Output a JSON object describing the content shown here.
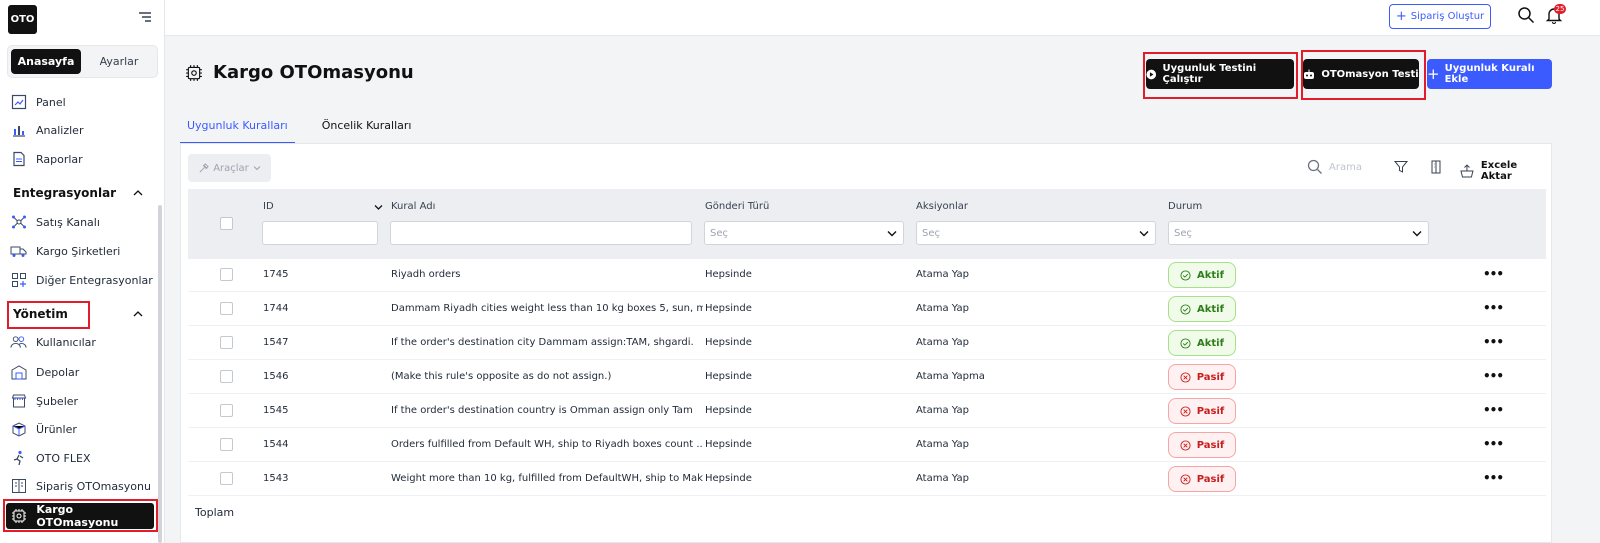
{
  "brand": {
    "logo": "OTO"
  },
  "sidebar": {
    "segment": {
      "home": "Anasayfa",
      "settings": "Ayarlar"
    },
    "top_items": [
      {
        "label": "Panel",
        "icon": "panel-icon"
      },
      {
        "label": "Analizler",
        "icon": "chart-icon"
      },
      {
        "label": "Raporlar",
        "icon": "report-icon"
      }
    ],
    "section_integrations": "Entegrasyonlar",
    "integration_items": [
      {
        "label": "Satış Kanalı",
        "icon": "network-icon"
      },
      {
        "label": "Kargo Şirketleri",
        "icon": "truck-icon"
      },
      {
        "label": "Diğer Entegrasyonlar",
        "icon": "grid-plus-icon"
      }
    ],
    "section_management": "Yönetim",
    "management_items": [
      {
        "label": "Kullanıcılar",
        "icon": "users-icon"
      },
      {
        "label": "Depolar",
        "icon": "warehouse-icon"
      },
      {
        "label": "Şubeler",
        "icon": "store-icon"
      },
      {
        "label": "Ürünler",
        "icon": "box-icon"
      },
      {
        "label": "OTO FLEX",
        "icon": "runner-icon"
      },
      {
        "label": "Sipariş OTOmasyonu",
        "icon": "order-automation-icon"
      },
      {
        "label": "Kargo OTOmasyonu",
        "icon": "cargo-automation-icon"
      }
    ]
  },
  "topbar": {
    "create_order": "Sipariş Oluştur",
    "notification_count": "25"
  },
  "page": {
    "title": "Kargo OTOmasyonu",
    "btn_run_test": "Uygunluk Testini Çalıştır",
    "btn_automation_test": "OTOmasyon Testi",
    "btn_add_rule": "Uygunluk Kuralı Ekle",
    "tabs": [
      "Uygunluk Kuralları",
      "Öncelik Kuralları"
    ]
  },
  "toolbar": {
    "tools": "Araçlar",
    "search_placeholder": "Arama",
    "export": "Excele Aktar"
  },
  "table": {
    "headers": {
      "id": "ID",
      "name": "Kural Adı",
      "shipment": "Gönderi Türü",
      "actions": "Aksiyonlar",
      "status": "Durum"
    },
    "select_placeholder": "Seç",
    "rows": [
      {
        "id": "1745",
        "name": "Riyadh orders",
        "shipment": "Hepsinde",
        "action": "Atama Yap",
        "status": "Aktif"
      },
      {
        "id": "1744",
        "name": "Dammam Riyadh cities weight less than 10 kg boxes 5, sun, m...",
        "shipment": "Hepsinde",
        "action": "Atama Yap",
        "status": "Aktif"
      },
      {
        "id": "1547",
        "name": "If the order's destination city Dammam assign:TAM, shgardi.",
        "shipment": "Hepsinde",
        "action": "Atama Yap",
        "status": "Aktif"
      },
      {
        "id": "1546",
        "name": "(Make this rule's opposite as do not assign.)",
        "shipment": "Hepsinde",
        "action": "Atama Yapma",
        "status": "Pasif"
      },
      {
        "id": "1545",
        "name": "If the order's destination country is Omman assign only Tam",
        "shipment": "Hepsinde",
        "action": "Atama Yap",
        "status": "Pasif"
      },
      {
        "id": "1544",
        "name": "Orders fulfilled from Default WH, ship to Riyadh boxes count ...",
        "shipment": "Hepsinde",
        "action": "Atama Yap",
        "status": "Pasif"
      },
      {
        "id": "1543",
        "name": "Weight more than 10 kg, fulfilled from DefaultWH, ship to Mak...",
        "shipment": "Hepsinde",
        "action": "Atama Yap",
        "status": "Pasif"
      }
    ],
    "total_label": "Toplam"
  },
  "colors": {
    "accent": "#3b5bff",
    "dark": "#111111",
    "highlight": "#e11d2a",
    "active": "#2f7d1d",
    "passive": "#c81e1e"
  }
}
